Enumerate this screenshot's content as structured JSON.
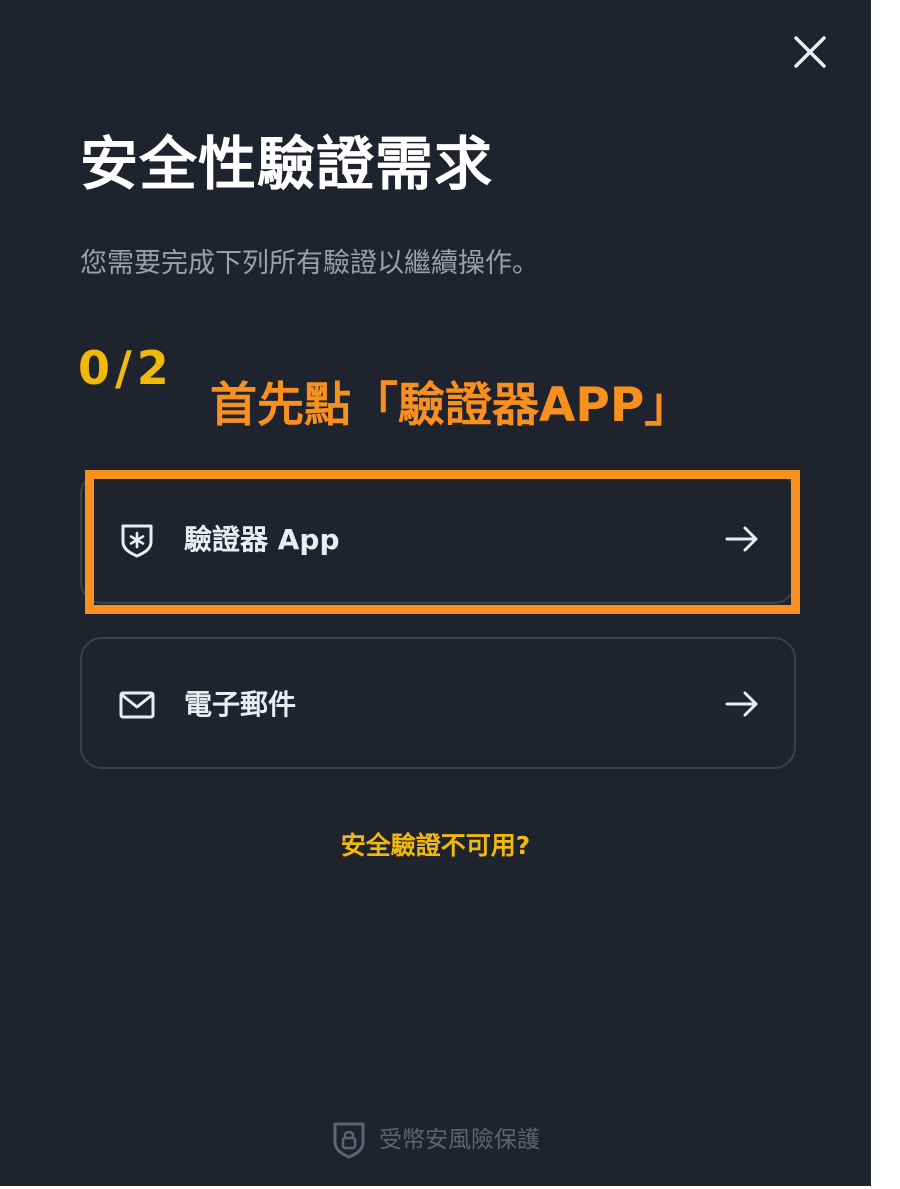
{
  "dialog": {
    "title": "安全性驗證需求",
    "subtitle": "您需要完成下列所有驗證以繼續操作。",
    "progress": "0/2",
    "annotation": "首先點「驗證器APP」",
    "close_icon": "close-icon"
  },
  "options": [
    {
      "icon": "authenticator-shield-icon",
      "label": "驗證器 App",
      "arrow_icon": "arrow-right-icon"
    },
    {
      "icon": "mail-icon",
      "label": "電子郵件",
      "arrow_icon": "arrow-right-icon"
    }
  ],
  "help_link": "安全驗證不可用?",
  "footer": {
    "icon": "shield-lock-icon",
    "text": "受幣安風險保護"
  },
  "colors": {
    "background": "#1f232e",
    "accent_yellow": "#f0b90b",
    "annotation_orange": "#f7901e",
    "text_primary": "#ffffff",
    "text_secondary": "#9a9fa9"
  }
}
